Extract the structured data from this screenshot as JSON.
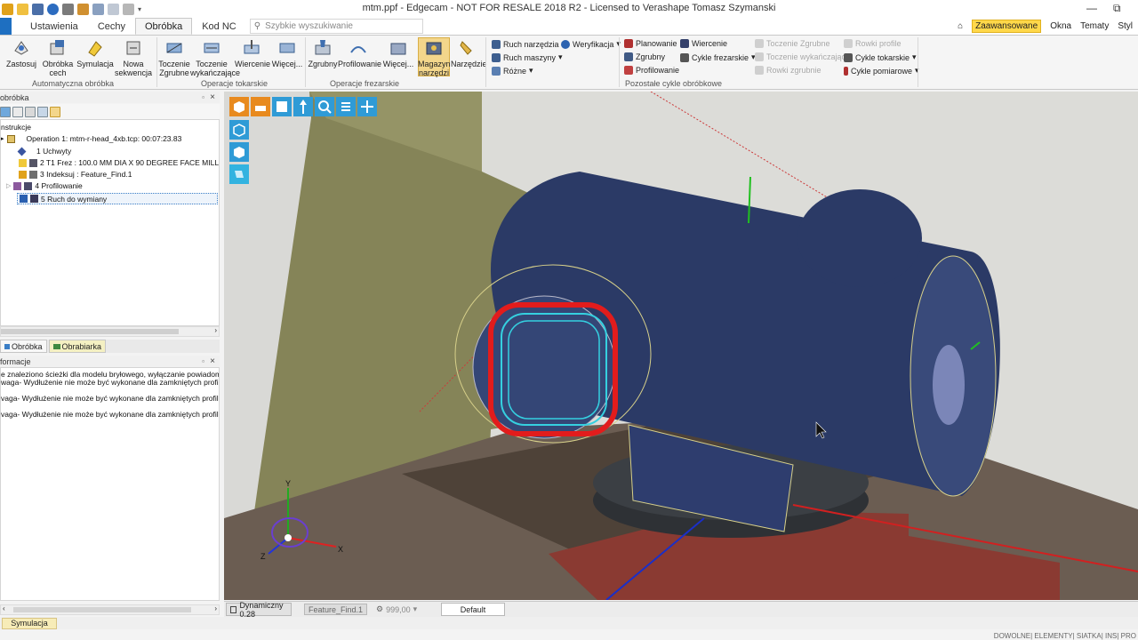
{
  "app": {
    "title": "mtm.ppf - Edgecam - NOT FOR RESALE 2018 R2 - Licensed to Verashape Tomasz Szymanski",
    "win_controls": {
      "minimize": "—",
      "maximize": "⧉"
    },
    "colors": {
      "accent": "#1e6fc1",
      "highlight": "#ffd84a",
      "selection": "#3a7ec6"
    }
  },
  "tabs": {
    "file_tab": "",
    "items": [
      {
        "label": "Ustawienia"
      },
      {
        "label": "Cechy"
      },
      {
        "label": "Obróbka",
        "active": true
      },
      {
        "label": "Kod NC"
      }
    ],
    "search_placeholder": "Szybkie wyszukiwanie",
    "right": {
      "mode": "Zaawansowane",
      "windows": "Okna",
      "themes": "Tematy",
      "style": "Styl"
    }
  },
  "ribbon": {
    "automation": {
      "label": "Automatyczna obróbka",
      "buttons": [
        {
          "label": "Zastosuj",
          "icon": "apply-icon"
        },
        {
          "label": "Obróbka cech",
          "icon": "feature-machining-icon"
        },
        {
          "label": "Symulacja",
          "icon": "simulation-icon"
        },
        {
          "label": "Nowa sekwencja",
          "icon": "new-sequence-icon"
        }
      ]
    },
    "turning": {
      "label": "Operacje tokarskie",
      "buttons": [
        {
          "label": "Toczenie Zgrubne",
          "icon": "rough-turning-icon"
        },
        {
          "label": "Toczenie wykańczające",
          "icon": "finish-turning-icon"
        },
        {
          "label": "Wiercenie",
          "icon": "drilling-icon"
        },
        {
          "label": "Więcej...",
          "icon": "more-icon"
        }
      ]
    },
    "milling": {
      "label": "Operacje frezarskie",
      "buttons": [
        {
          "label": "Zgrubny",
          "icon": "roughing-icon"
        },
        {
          "label": "Profilowanie",
          "icon": "profiling-icon"
        },
        {
          "label": "Więcej...",
          "icon": "more-icon"
        }
      ]
    },
    "tools": {
      "buttons": [
        {
          "label": "Magazyn narzędzi",
          "icon": "tool-store-icon"
        },
        {
          "label": "Narzędzie",
          "icon": "tool-icon"
        }
      ]
    },
    "small": {
      "col1": [
        "Ruch narzędzia",
        "Ruch maszyny",
        "Różne"
      ],
      "col2": [
        "Weryfikacja"
      ]
    },
    "other_cycles": {
      "label": "Pozostałe cykle obróbkowe",
      "col1": [
        "Planowanie",
        "Zgrubny",
        "Profilowanie"
      ],
      "col2": [
        "Wiercenie",
        "Cykle frezarskie"
      ],
      "col3": [
        "Toczenie Zgrubne",
        "Toczenie wykańczające",
        "Rowki zgrubnie"
      ],
      "col4": [
        "Rowki profile",
        "Cykle tokarskie",
        "Cykle pomiarowe"
      ]
    }
  },
  "left_panel": {
    "title": "obróbka",
    "tree": {
      "root": "nstrukcje",
      "operation": "Operation 1: mtm-r-head_4xb.tcp: 00:07:23.83",
      "items": [
        "1 Uchwyty",
        "2 T1 Frez : 100.0 MM DIA X 90 DEGREE FACE MILL",
        "3 Indeksuj : Feature_Find.1",
        "4 Profilowanie",
        "5 Ruch do wymiany"
      ]
    },
    "bottom_tabs": [
      "Obróbka",
      "Obrabiarka"
    ],
    "info_title": "formacje",
    "messages": [
      "e znaleziono ścieżki dla modelu bryłowego, wyłączanie powiadomień",
      "waga- Wydłużenie nie może być wykonane dla zamkniętych profili",
      "vaga- Wydłużenie nie może być wykonane dla zamkniętych profili",
      "vaga- Wydłużenie nie może być wykonane dla zamkniętych profili"
    ]
  },
  "viewport": {
    "axes": {
      "x": "X",
      "y": "Y",
      "z": "Z"
    }
  },
  "statusbar": {
    "view_mode": "Dynamiczny 0.28",
    "feature": "Feature_Find.1",
    "value": "999,00",
    "layer": "Default",
    "bottom_tab": "Symulacja",
    "right_text": "DOWOLNE| ELEMENTY| SIATKA| INS| PRO"
  }
}
